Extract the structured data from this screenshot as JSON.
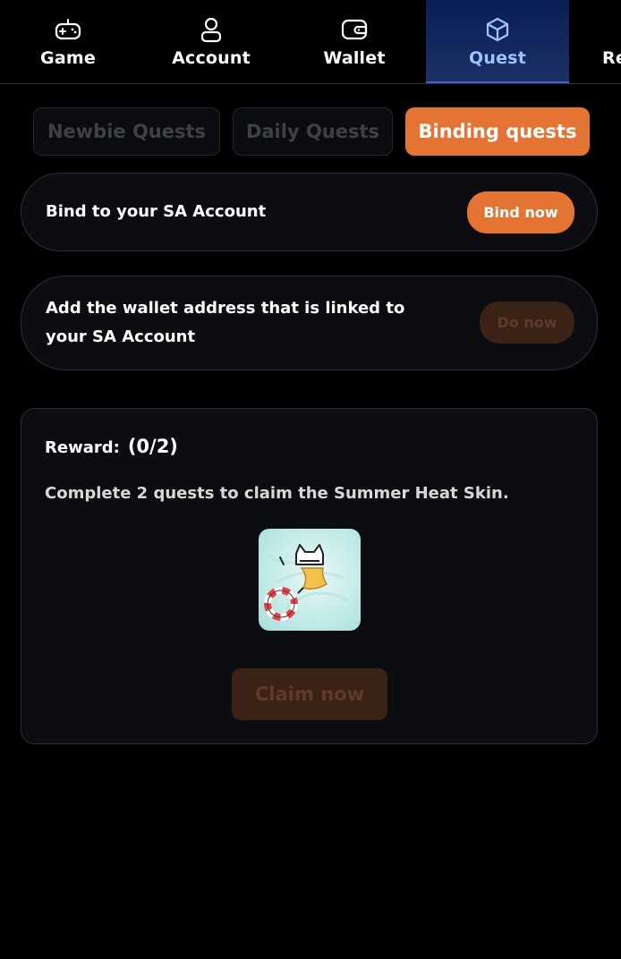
{
  "nav": {
    "items": [
      {
        "label": "Game",
        "icon": "gamepad-icon"
      },
      {
        "label": "Account",
        "icon": "user-icon"
      },
      {
        "label": "Wallet",
        "icon": "wallet-icon"
      },
      {
        "label": "Quest",
        "icon": "cube-icon",
        "active": true
      },
      {
        "label": "Re",
        "icon": ""
      }
    ]
  },
  "tabs": [
    {
      "label": "Newbie Quests",
      "active": false
    },
    {
      "label": "Daily Quests",
      "active": false
    },
    {
      "label": "Binding quests",
      "active": true
    }
  ],
  "quests": [
    {
      "text": "Bind to your SA Account",
      "button": "Bind now",
      "button_state": "enabled"
    },
    {
      "text_line1": "Add the wallet address that is linked to",
      "text_line2": "your SA Account",
      "button": "Do now",
      "button_state": "disabled"
    }
  ],
  "reward": {
    "label": "Reward:",
    "progress": "(0/2)",
    "description": "Complete 2 quests to claim the Summer Heat Skin.",
    "claim_button": "Claim now",
    "claim_state": "disabled"
  },
  "colors": {
    "accent": "#e37433",
    "accent_disabled": "#3a2216",
    "active_tab_text": "#9fc3ff",
    "background": "#000000",
    "card": "#0c0d10"
  }
}
